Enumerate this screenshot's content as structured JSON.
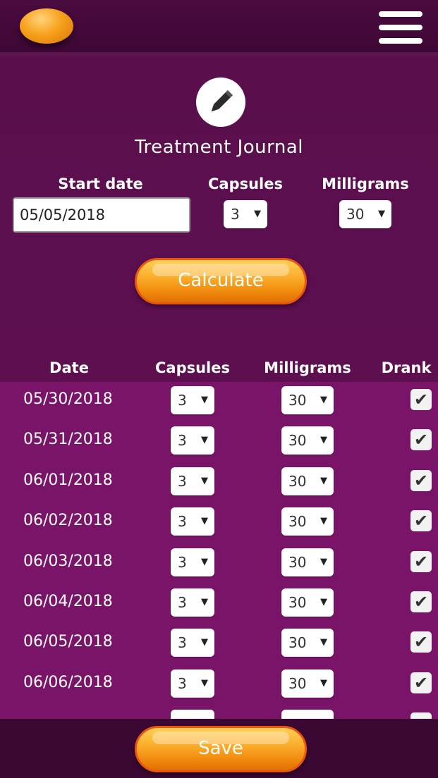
{
  "header": {
    "logo_icon": "capsule-logo",
    "menu_icon": "hamburger-menu-icon"
  },
  "form": {
    "title": "Treatment Journal",
    "start_date_label": "Start date",
    "start_date_value": "05/05/2018",
    "capsules_label": "Capsules",
    "capsules_value": "3",
    "milligrams_label": "Milligrams",
    "milligrams_value": "30",
    "calculate_label": "Calculate"
  },
  "table": {
    "headers": [
      "Date",
      "Capsules",
      "Milligrams",
      "Drank"
    ],
    "rows": [
      {
        "date": "05/30/2018",
        "capsules": "3",
        "milligrams": "30",
        "drank": true
      },
      {
        "date": "05/31/2018",
        "capsules": "3",
        "milligrams": "30",
        "drank": true
      },
      {
        "date": "06/01/2018",
        "capsules": "3",
        "milligrams": "30",
        "drank": true
      },
      {
        "date": "06/02/2018",
        "capsules": "3",
        "milligrams": "30",
        "drank": true
      },
      {
        "date": "06/03/2018",
        "capsules": "3",
        "milligrams": "30",
        "drank": true
      },
      {
        "date": "06/04/2018",
        "capsules": "3",
        "milligrams": "30",
        "drank": true
      },
      {
        "date": "06/05/2018",
        "capsules": "3",
        "milligrams": "30",
        "drank": true
      },
      {
        "date": "06/06/2018",
        "capsules": "3",
        "milligrams": "30",
        "drank": true
      }
    ]
  },
  "footer": {
    "save_label": "Save"
  },
  "colors": {
    "background": "#5b0f4d",
    "rows": "#7a1469",
    "accent": "#f7a21b"
  }
}
